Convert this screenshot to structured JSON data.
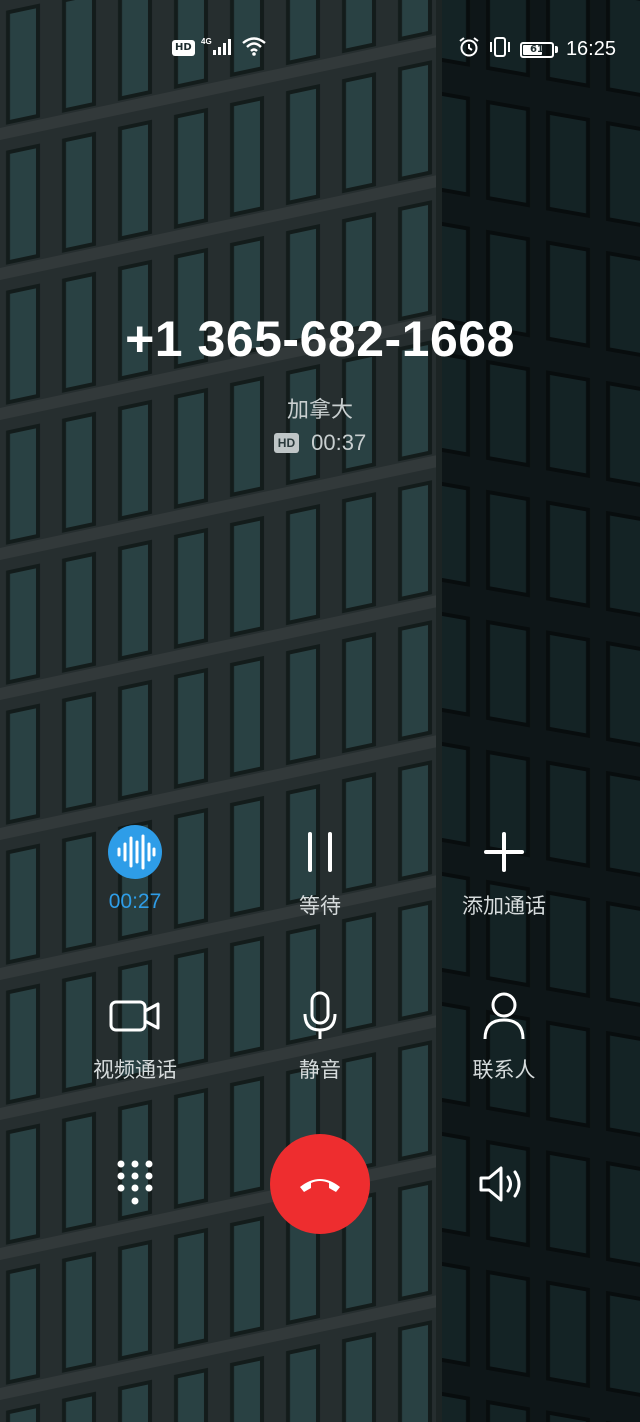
{
  "status": {
    "time": "16:25",
    "battery": "61",
    "network": "4G",
    "hd": "HD"
  },
  "call": {
    "number": "+1 365-682-1668",
    "location": "加拿大",
    "hd_badge": "HD",
    "duration": "00:37"
  },
  "controls": {
    "recording_label": "00:27",
    "hold_label": "等待",
    "add_call_label": "添加通话",
    "video_call_label": "视频通话",
    "mute_label": "静音",
    "contacts_label": "联系人"
  },
  "colors": {
    "accent": "#2e9de8",
    "end_call": "#ee2d2f",
    "text_secondary": "#c9cfd0"
  },
  "icons": [
    "hd-icon",
    "signal-4g-icon",
    "wifi-icon",
    "alarm-icon",
    "vibrate-icon",
    "battery-icon",
    "recording-waveform-icon",
    "pause-icon",
    "plus-icon",
    "video-camera-icon",
    "microphone-icon",
    "person-icon",
    "dialpad-icon",
    "end-call-icon",
    "speaker-icon"
  ]
}
